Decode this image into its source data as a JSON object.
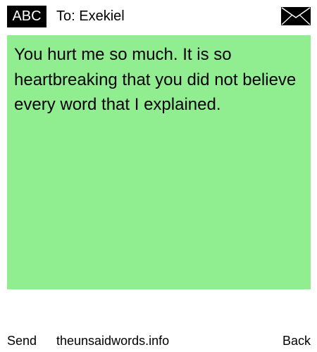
{
  "header": {
    "badge_label": "ABC",
    "recipient": "To: Exekiel",
    "envelope_icon": "envelope-icon"
  },
  "message": {
    "text": "You hurt me so much. It is so heartbreaking that you did not believe every word that I explained.",
    "background_color": "#90ee90"
  },
  "footer": {
    "send_label": "Send",
    "site_label": "theunsaidwords.info",
    "back_label": "Back"
  }
}
